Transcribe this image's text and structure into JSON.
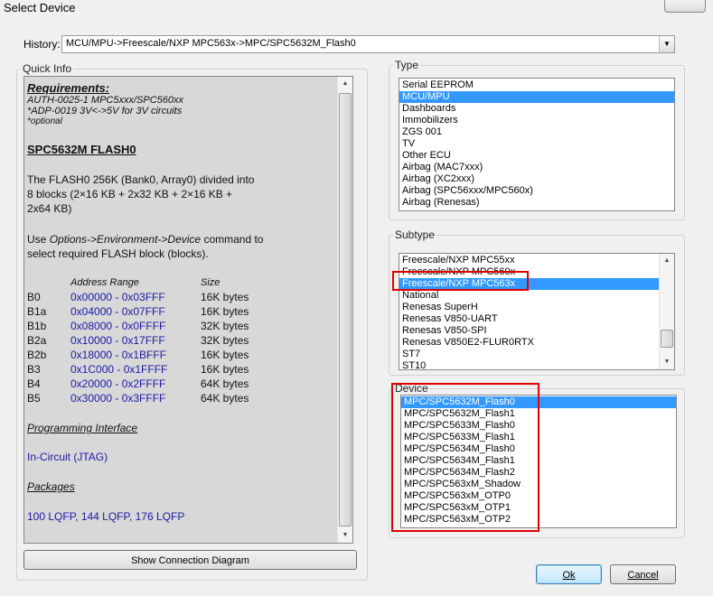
{
  "window": {
    "title": "Select Device"
  },
  "history": {
    "label": "History:",
    "value": "MCU/MPU->Freescale/NXP MPC563x->MPC/SPC5632M_Flash0"
  },
  "quick_info": {
    "label": "Quick Info",
    "requirements_title": "Requirements:",
    "req_line1": "AUTH-0025-1 MPC5xxx/SPC560xx",
    "req_line2": "*ADP-0019 3V<->5V for 3V circuits",
    "req_line3": "*optional",
    "part_title": "SPC5632M FLASH0",
    "desc1": "The FLASH0 256K (Bank0, Array0) divided into",
    "desc2": "8 blocks (2×16 KB + 2x32 KB +  2×16 KB +",
    "desc3": "2x64 KB)",
    "use_prefix": "Use ",
    "use_cmd": "Options->Environment->Device",
    "use_suffix": " command to",
    "use_line2": "select required FLASH block (blocks).",
    "col_address": "Address Range",
    "col_size": "Size",
    "blocks": [
      {
        "name": "B0",
        "range": "0x00000 - 0x03FFF",
        "size": "16K bytes"
      },
      {
        "name": "B1a",
        "range": "0x04000 - 0x07FFF",
        "size": "16K bytes"
      },
      {
        "name": "B1b",
        "range": "0x08000 - 0x0FFFF",
        "size": "32K bytes"
      },
      {
        "name": "B2a",
        "range": "0x10000 - 0x17FFF",
        "size": "32K bytes"
      },
      {
        "name": "B2b",
        "range": "0x18000 - 0x1BFFF",
        "size": "16K bytes"
      },
      {
        "name": "B3",
        "range": "0x1C000 - 0x1FFFF",
        "size": "16K bytes"
      },
      {
        "name": "B4",
        "range": "0x20000 - 0x2FFFF",
        "size": "64K bytes"
      },
      {
        "name": "B5",
        "range": "0x30000 - 0x3FFFF",
        "size": "64K bytes"
      }
    ],
    "prog_heading": "Programming Interface",
    "prog_value": "In-Circuit (JTAG)",
    "packages_heading": "Packages",
    "packages_value": "100 LQFP, 144 LQFP, 176 LQFP"
  },
  "type": {
    "label": "Type",
    "items": [
      "Serial EEPROM",
      "MCU/MPU",
      "Dashboards",
      "Immobilizers",
      "ZGS 001",
      "TV",
      "Other ECU",
      "Airbag (MAC7xxx)",
      "Airbag (XC2xxx)",
      "Airbag (SPC56xxx/MPC560x)",
      "Airbag (Renesas)"
    ],
    "selected": "MCU/MPU"
  },
  "subtype": {
    "label": "Subtype",
    "items": [
      "Freescale/NXP MPC55xx",
      "Freescale/NXP MPC560x",
      "Freescale/NXP MPC563x",
      "National",
      "Renesas SuperH",
      "Renesas V850-UART",
      "Renesas V850-SPI",
      "Renesas V850E2-FLUR0RTX",
      "ST7",
      "ST10"
    ],
    "selected": "Freescale/NXP MPC563x"
  },
  "device": {
    "label": "Device",
    "items": [
      "MPC/SPC5632M_Flash0",
      "MPC/SPC5632M_Flash1",
      "MPC/SPC5633M_Flash0",
      "MPC/SPC5633M_Flash1",
      "MPC/SPC5634M_Flash0",
      "MPC/SPC5634M_Flash1",
      "MPC/SPC5634M_Flash2",
      "MPC/SPC563xM_Shadow",
      "MPC/SPC563xM_OTP0",
      "MPC/SPC563xM_OTP1",
      "MPC/SPC563xM_OTP2"
    ],
    "selected": "MPC/SPC5632M_Flash0"
  },
  "buttons": {
    "show_diagram": "Show Connection Diagram",
    "ok": "Ok",
    "cancel": "Cancel"
  },
  "colors": {
    "selection": "#3399ff",
    "highlight_annotation": "#e00000",
    "info_background": "#d8d8d8"
  }
}
